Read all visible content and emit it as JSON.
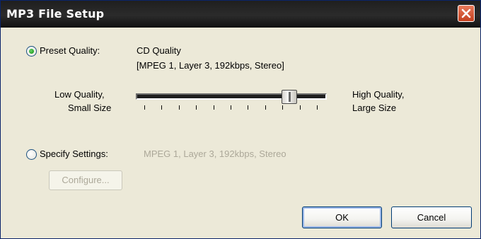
{
  "window": {
    "title": "MP3 File Setup"
  },
  "preset": {
    "label": "Preset Quality:",
    "selected": true,
    "quality_name": "CD Quality",
    "quality_detail": "[MPEG 1, Layer 3, 192kbps, Stereo]"
  },
  "slider": {
    "low_line1": "Low Quality,",
    "low_line2": "Small Size",
    "high_line1": "High Quality,",
    "high_line2": "Large Size",
    "tick_count": 11,
    "position_fraction": 0.84
  },
  "specify": {
    "label": "Specify Settings:",
    "selected": false,
    "value": "MPEG 1, Layer 3, 192kbps, Stereo",
    "configure_label": "Configure..."
  },
  "buttons": {
    "ok": "OK",
    "cancel": "Cancel"
  },
  "colors": {
    "title_bar": "#1f1f1f",
    "close_button": "#d0502e",
    "dialog_bg": "#ece9d8",
    "radio_selected": "#21a121",
    "disabled_text": "#aca899"
  }
}
